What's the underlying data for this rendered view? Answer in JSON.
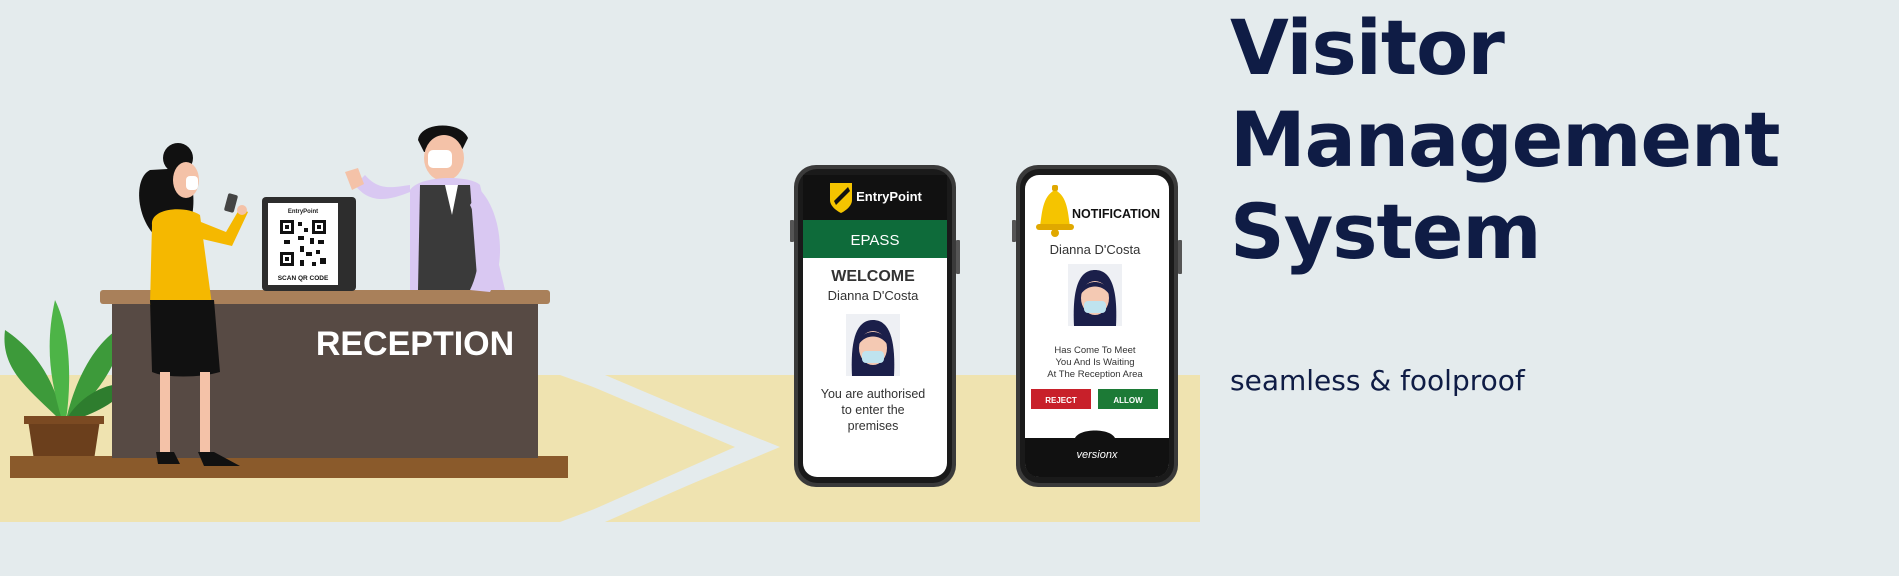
{
  "hero": {
    "title_line1": "Visitor",
    "title_line2": "Management",
    "title_line3": "System",
    "subtitle": "seamless & foolproof"
  },
  "illustration": {
    "desk_label": "RECEPTION",
    "qr_stand_brand": "EntryPoint",
    "qr_stand_caption": "SCAN QR CODE"
  },
  "phone_epass": {
    "brand": "EntryPoint",
    "header": "EPASS",
    "welcome": "WELCOME",
    "visitor_name": "Dianna D'Costa",
    "message_line1": "You are authorised",
    "message_line2": "to enter the",
    "message_line3": "premises"
  },
  "phone_notification": {
    "header": "NOTIFICATION",
    "visitor_name": "Dianna D'Costa",
    "message_line1": "Has Come To Meet",
    "message_line2": "You And Is Waiting",
    "message_line3": "At The Reception Area",
    "reject_label": "REJECT",
    "allow_label": "ALLOW",
    "footer_brand": "versionx"
  },
  "colors": {
    "background": "#e4ebed",
    "floor": "#efe3b0",
    "title": "#0f1c45",
    "epass_green": "#0e6b3a",
    "reject_red": "#c8202a",
    "allow_green": "#1c7a36"
  }
}
